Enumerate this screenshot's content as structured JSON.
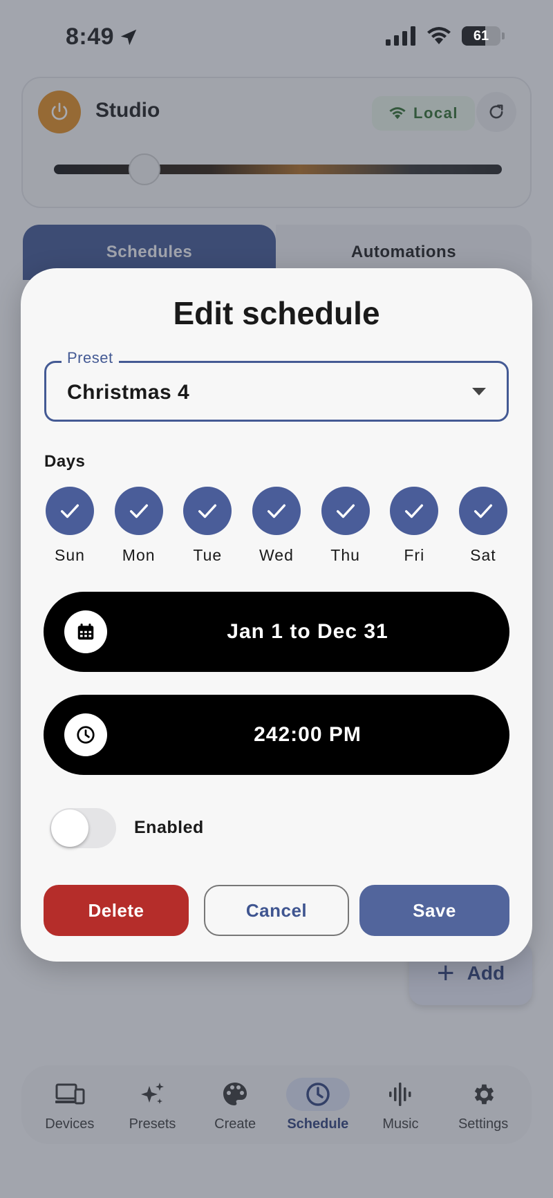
{
  "status_bar": {
    "time": "8:49",
    "battery": "61"
  },
  "device": {
    "name": "Studio",
    "connection": "Local"
  },
  "tabs": [
    {
      "label": "Schedules"
    },
    {
      "label": "Automations"
    }
  ],
  "fab": {
    "label": "Add"
  },
  "nav": [
    {
      "label": "Devices",
      "icon": "devices-icon"
    },
    {
      "label": "Presets",
      "icon": "sparkle-icon"
    },
    {
      "label": "Create",
      "icon": "palette-icon"
    },
    {
      "label": "Schedule",
      "icon": "clock-icon"
    },
    {
      "label": "Music",
      "icon": "waveform-icon"
    },
    {
      "label": "Settings",
      "icon": "gear-icon"
    }
  ],
  "dialog": {
    "title": "Edit schedule",
    "preset_label": "Preset",
    "preset_value": "Christmas 4",
    "days_label": "Days",
    "days": [
      {
        "label": "Sun",
        "checked": true
      },
      {
        "label": "Mon",
        "checked": true
      },
      {
        "label": "Tue",
        "checked": true
      },
      {
        "label": "Wed",
        "checked": true
      },
      {
        "label": "Thu",
        "checked": true
      },
      {
        "label": "Fri",
        "checked": true
      },
      {
        "label": "Sat",
        "checked": true
      }
    ],
    "date_range": "Jan 1 to Dec 31",
    "time": "242:00 PM",
    "enabled_label": "Enabled",
    "enabled": false,
    "buttons": {
      "delete": "Delete",
      "cancel": "Cancel",
      "save": "Save"
    }
  },
  "colors": {
    "primary": "#4a5d99",
    "delete": "#b52d2a",
    "power": "#e08a1e",
    "local_badge_text": "#2d6b2b"
  }
}
